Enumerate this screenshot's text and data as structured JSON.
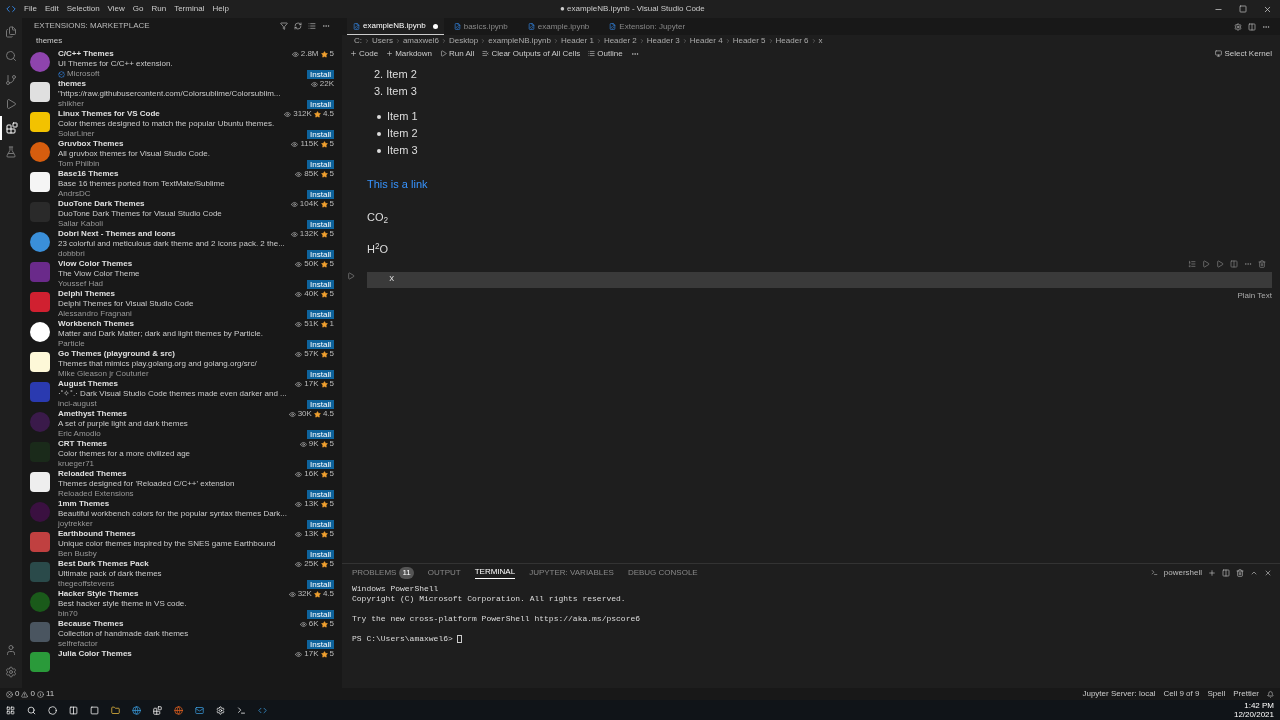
{
  "window": {
    "title": "● exampleNB.ipynb - Visual Studio Code"
  },
  "menu": [
    "File",
    "Edit",
    "Selection",
    "View",
    "Go",
    "Run",
    "Terminal",
    "Help"
  ],
  "activity_bar": [
    {
      "selected": false
    },
    {
      "selected": false
    },
    {
      "selected": false
    },
    {
      "selected": false
    },
    {
      "selected": true
    },
    {
      "selected": false
    }
  ],
  "sidebar": {
    "title": "EXTENSIONS: MARKETPLACE",
    "search": {
      "value": "themes"
    },
    "extensions": [
      {
        "name": "C/C++ Themes",
        "description": "UI Themes for C/C++ extension.",
        "publisher": "Microsoft",
        "verified": true,
        "installs": "2.8M",
        "rating": "5",
        "action": "Install",
        "color": "#8e44ad"
      },
      {
        "name": "themes",
        "description": "\"https://raw.githubusercontent.com/Colorsublime/Colorsublim...",
        "publisher": "shikher",
        "verified": false,
        "installs": "22K",
        "action": "Install",
        "color": "#e0e0e0"
      },
      {
        "name": "Linux Themes for VS Code",
        "description": "Color themes designed to match the popular Ubuntu themes.",
        "publisher": "SolarLiner",
        "verified": false,
        "installs": "312K",
        "rating": "4.5",
        "action": "Install",
        "color": "#f2c200"
      },
      {
        "name": "Gruvbox Themes",
        "description": "All gruvbox themes for Visual Studio Code.",
        "publisher": "Tom Philbin",
        "verified": false,
        "installs": "115K",
        "rating": "5",
        "action": "Install",
        "color": "#d65d0e"
      },
      {
        "name": "Base16 Themes",
        "description": "Base 16 themes ported from TextMate/Sublime",
        "publisher": "AndrsDC",
        "verified": false,
        "installs": "85K",
        "rating": "5",
        "action": "Install",
        "color": "#f5f5f5"
      },
      {
        "name": "DuoTone Dark Themes",
        "description": "DuoTone Dark Themes for Visual Studio Code",
        "publisher": "Sallar Kaboli",
        "verified": false,
        "installs": "104K",
        "rating": "5",
        "action": "Install",
        "color": "#2a2a2a"
      },
      {
        "name": "Dobri Next - Themes and Icons",
        "description": "23 colorful and meticulous dark theme and 2 Icons pack. 2 the...",
        "publisher": "dobbbri",
        "verified": false,
        "installs": "132K",
        "rating": "5",
        "action": "Install",
        "color": "#3a8fd9"
      },
      {
        "name": "Viow Color Themes",
        "description": "The Viow Color Theme",
        "publisher": "Youssef Had",
        "verified": false,
        "installs": "50K",
        "rating": "5",
        "action": "Install",
        "color": "#6a2a8a"
      },
      {
        "name": "Delphi Themes",
        "description": "Delphi Themes for Visual Studio Code",
        "publisher": "Alessandro Fragnani",
        "verified": false,
        "installs": "40K",
        "rating": "5",
        "action": "Install",
        "color": "#d02030"
      },
      {
        "name": "Workbench Themes",
        "description": "Matter and Dark Matter; dark and light themes by Particle.",
        "publisher": "Particle",
        "verified": false,
        "installs": "51K",
        "rating": "1",
        "action": "Install",
        "color": "#ffffff"
      },
      {
        "name": "Go Themes (playground & src)",
        "description": "Themes that mimics play.golang.org and golang.org/src/",
        "publisher": "Mike Gleason jr Couturier",
        "verified": false,
        "installs": "57K",
        "rating": "5",
        "action": "Install",
        "color": "#fdf8d8"
      },
      {
        "name": "August Themes",
        "description": "·˚✧˚.· Dark Visual Studio Code themes made even darker and ...",
        "publisher": "inci-august",
        "verified": false,
        "installs": "17K",
        "rating": "5",
        "action": "Install",
        "color": "#2a3ab0"
      },
      {
        "name": "Amethyst Themes",
        "description": "A set of purple light and dark themes",
        "publisher": "Eric Amodio",
        "verified": false,
        "installs": "30K",
        "rating": "4.5",
        "action": "Install",
        "color": "#3a1a4a"
      },
      {
        "name": "CRT Themes",
        "description": "Color themes for a more civilized age",
        "publisher": "krueger71",
        "verified": false,
        "installs": "9K",
        "rating": "5",
        "action": "Install",
        "color": "#1a2a1a"
      },
      {
        "name": "Reloaded Themes",
        "description": "Themes designed for 'Reloaded C/C++' extension",
        "publisher": "Reloaded Extensions",
        "verified": false,
        "installs": "16K",
        "rating": "5",
        "action": "Install",
        "color": "#eeeeee"
      },
      {
        "name": "1mm Themes",
        "description": "Beautiful workbench colors for the popular syntax themes Dark...",
        "publisher": "joytrekker",
        "verified": false,
        "installs": "13K",
        "rating": "5",
        "action": "Install",
        "color": "#3a1040"
      },
      {
        "name": "Earthbound Themes",
        "description": "Unique color themes inspired by the SNES game Earthbound",
        "publisher": "Ben Busby",
        "verified": false,
        "installs": "13K",
        "rating": "5",
        "action": "Install",
        "color": "#c04040"
      },
      {
        "name": "Best Dark Themes Pack",
        "description": "Ultimate pack of dark themes",
        "publisher": "thegeoffstevens",
        "verified": false,
        "installs": "25K",
        "rating": "5",
        "action": "Install",
        "color": "#2a4a4a"
      },
      {
        "name": "Hacker Style Themes",
        "description": "Best hacker style theme in VS code.",
        "publisher": "bin70",
        "verified": false,
        "installs": "32K",
        "rating": "4.5",
        "action": "Install",
        "color": "#1a5a1a"
      },
      {
        "name": "Because Themes",
        "description": "Collection of handmade dark themes",
        "publisher": "selfrefactor",
        "verified": false,
        "installs": "6K",
        "rating": "5",
        "action": "Install",
        "color": "#4a5560"
      },
      {
        "name": "Julia Color Themes",
        "installs": "17K",
        "rating": "5",
        "color": "#2a9a3a"
      }
    ]
  },
  "tabs": [
    {
      "label": "exampleNB.ipynb",
      "selected": true,
      "dirty": true
    },
    {
      "label": "basics.ipynb",
      "selected": false,
      "dirty": false
    },
    {
      "label": "example.ipynb",
      "selected": false,
      "dirty": false
    },
    {
      "label": "Extension: Jupyter",
      "selected": false,
      "dirty": false
    }
  ],
  "breadcrumbs": [
    "C:",
    "Users",
    "amaxwel6",
    "Desktop",
    "exampleNB.ipynb",
    "Header 1",
    "Header 2",
    "Header 3",
    "Header 4",
    "Header 5",
    "Header 6",
    "x"
  ],
  "notebook_toolbar": [
    "Code",
    "Markdown",
    "Run All",
    "Clear Outputs of All Cells",
    "Outline"
  ],
  "kernel": "Select Kernel",
  "markdown": {
    "ordered": [
      {
        "number": "2.",
        "text": "Item 2"
      },
      {
        "number": "3.",
        "text": "Item 3"
      }
    ],
    "bullets": [
      "Item 1",
      "Item 2",
      "Item 3"
    ],
    "link": "This is a link",
    "formulas": [
      "CO$_{2}$",
      "H$^{2}$O"
    ]
  },
  "code_cell": {
    "source": "x",
    "language": "Plain Text"
  },
  "panel": {
    "tabs": [
      {
        "label": "PROBLEMS",
        "selected": false,
        "count": "11"
      },
      {
        "label": "OUTPUT",
        "selected": false
      },
      {
        "label": "TERMINAL",
        "selected": true
      },
      {
        "label": "JUPYTER: VARIABLES",
        "selected": false
      },
      {
        "label": "DEBUG CONSOLE",
        "selected": false
      }
    ],
    "shell": "powershell",
    "terminal": [
      [
        "Windows PowerShell",
        "Copyright (C) Microsoft Corporation. All rights reserved."
      ],
      [
        "Try the new cross-platform PowerShell https://aka.ms/pscore6"
      ],
      [
        "PS C:\\Users\\amaxwel6>"
      ]
    ]
  },
  "status_bar": {
    "errors": "0",
    "warnings": "0",
    "info": "11",
    "items": [
      "Jupyter Server: local",
      "Cell 9 of 9",
      "Spell",
      "Prettier"
    ]
  },
  "taskbar": {
    "time": "1:42 PM",
    "date": "12/20/2021"
  }
}
